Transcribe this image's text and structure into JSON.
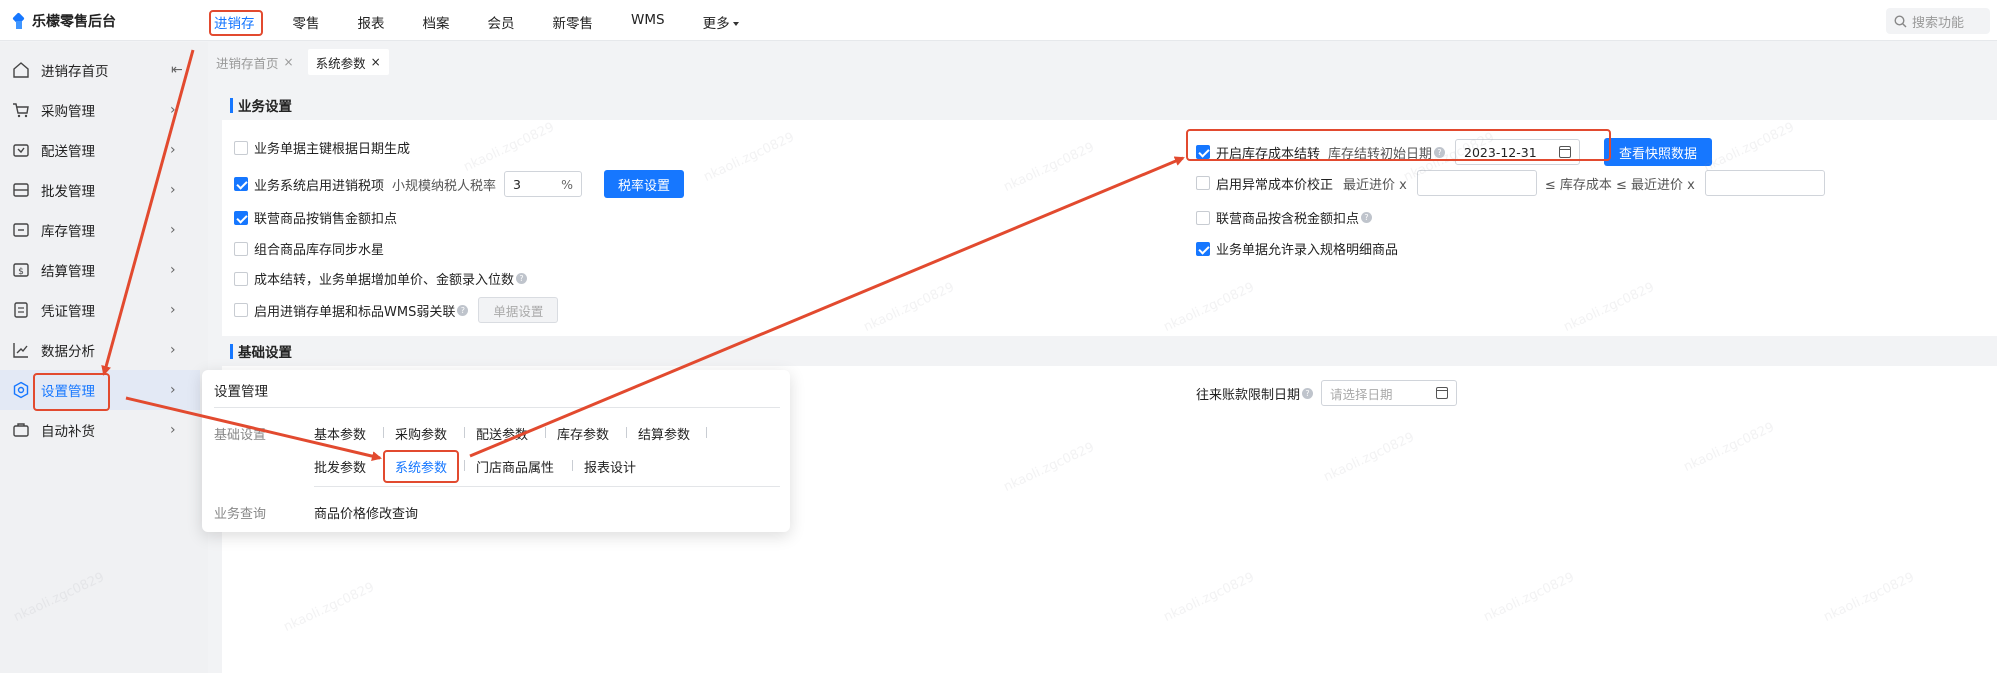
{
  "app": {
    "title": "乐檬零售后台"
  },
  "topnav": [
    {
      "label": "进销存",
      "active": true
    },
    {
      "label": "零售"
    },
    {
      "label": "报表"
    },
    {
      "label": "档案"
    },
    {
      "label": "会员"
    },
    {
      "label": "新零售"
    },
    {
      "label": "WMS"
    },
    {
      "label": "更多"
    }
  ],
  "search": {
    "placeholder": "搜索功能"
  },
  "sidebar": {
    "items": [
      {
        "label": "进销存首页",
        "icon": "home-icon"
      },
      {
        "label": "采购管理",
        "icon": "cart-icon"
      },
      {
        "label": "配送管理",
        "icon": "delivery-icon"
      },
      {
        "label": "批发管理",
        "icon": "wholesale-icon"
      },
      {
        "label": "库存管理",
        "icon": "inventory-icon"
      },
      {
        "label": "结算管理",
        "icon": "settlement-icon"
      },
      {
        "label": "凭证管理",
        "icon": "voucher-icon"
      },
      {
        "label": "数据分析",
        "icon": "chart-icon"
      },
      {
        "label": "设置管理",
        "icon": "settings-icon",
        "active": true
      },
      {
        "label": "自动补货",
        "icon": "replenish-icon"
      }
    ]
  },
  "tabs": [
    {
      "label": "进销存首页",
      "close": "×"
    },
    {
      "label": "系统参数",
      "close": "×",
      "current": true
    }
  ],
  "business": {
    "heading": "业务设置",
    "left": {
      "opt1": "业务单据主键根据日期生成",
      "opt2": "业务系统启用进销税项",
      "tax_label": "小规模纳税人税率",
      "tax_value": "3",
      "tax_unit": "%",
      "tax_button": "税率设置",
      "opt3": "联营商品按销售金额扣点",
      "opt4": "组合商品库存同步水星",
      "opt5": "成本结转，业务单据增加单价、金额录入位数",
      "opt6": "启用进销存单据和标品WMS弱关联",
      "doc_button": "单据设置"
    },
    "right": {
      "opt1": "开启库存成本结转",
      "start_date_label": "库存结转初始日期",
      "start_date_value": "2023-12-31",
      "snapshot_button": "查看快照数据",
      "opt2": "启用异常成本价校正",
      "recent_label": "最近进价 x",
      "le_label": "≤ 库存成本 ≤ 最近进价 x",
      "opt3": "联营商品按含税金额扣点",
      "opt4": "业务单据允许录入规格明细商品"
    }
  },
  "basic": {
    "heading": "基础设置",
    "limit_date_label": "往来账款限制日期",
    "limit_date_placeholder": "请选择日期"
  },
  "popup": {
    "title": "设置管理",
    "cat_basic": "基础设置",
    "basic_items": [
      "基本参数",
      "采购参数",
      "配送参数",
      "库存参数",
      "结算参数",
      "批发参数",
      "系统参数",
      "门店商品属性",
      "报表设计"
    ],
    "cat_query": "业务查询",
    "query_items": [
      "商品价格修改查询"
    ]
  },
  "watermark": "nkaoli.zgc0829",
  "colors": {
    "accent": "#1677ff",
    "annotation": "#e24a2f"
  }
}
